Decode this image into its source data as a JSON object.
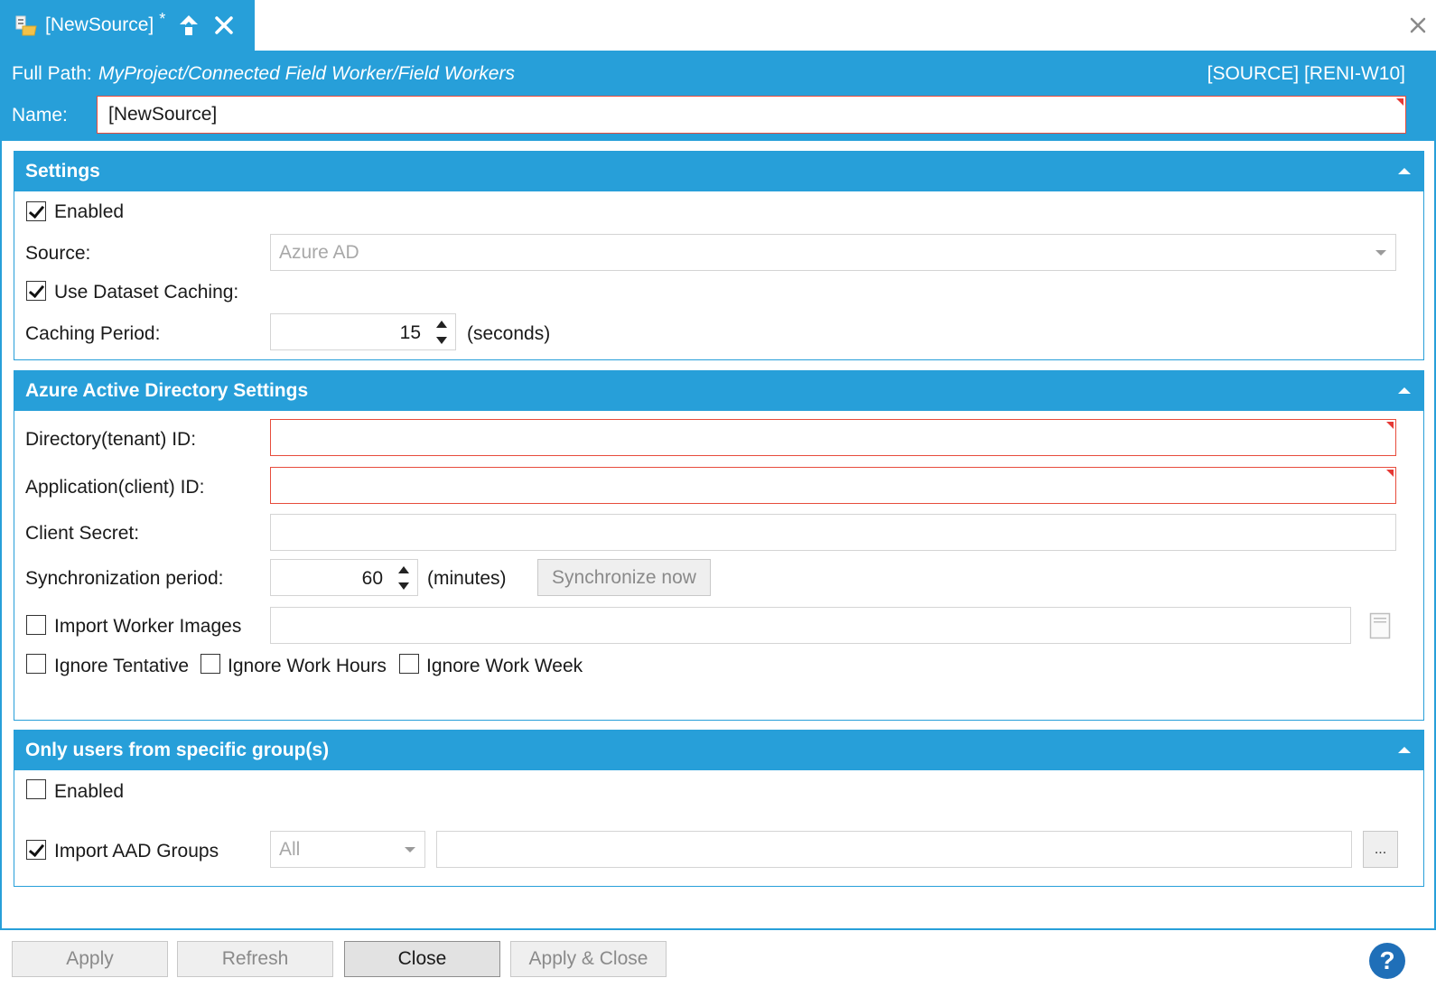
{
  "colors": {
    "accent": "#279fd9",
    "error": "#e74c3c",
    "help": "#1f6fb8"
  },
  "tab": {
    "title": "[NewSource]",
    "modified": "*",
    "icons": [
      "datasource-icon",
      "pin-up-icon",
      "close-icon"
    ]
  },
  "header": {
    "full_path_label": "Full Path:",
    "full_path_value": "MyProject/Connected Field Worker/Field Workers",
    "source_tag": "[SOURCE] [RENI-W10]",
    "name_label": "Name:",
    "name_value": "[NewSource]"
  },
  "settings": {
    "title": "Settings",
    "enabled_label": "Enabled",
    "enabled_checked": true,
    "source_label": "Source:",
    "source_value": "Azure AD",
    "caching_label": "Use Dataset Caching:",
    "caching_checked": true,
    "period_label": "Caching Period:",
    "period_value": "15",
    "period_unit": "(seconds)"
  },
  "aad": {
    "title": "Azure Active Directory Settings",
    "tenant_label": "Directory(tenant) ID:",
    "tenant_value": "",
    "client_label": "Application(client) ID:",
    "client_value": "",
    "secret_label": "Client Secret:",
    "secret_value": "",
    "sync_label": "Synchronization period:",
    "sync_value": "60",
    "sync_unit": "(minutes)",
    "sync_button": "Synchronize now",
    "import_images_label": "Import Worker Images",
    "import_images_checked": false,
    "ignore_tentative_label": "Ignore Tentative",
    "ignore_work_hours_label": "Ignore Work Hours",
    "ignore_work_week_label": "Ignore Work Week"
  },
  "groups": {
    "title": "Only users from specific group(s)",
    "enabled_label": "Enabled",
    "enabled_checked": false,
    "import_label": "Import AAD Groups",
    "import_checked": true,
    "filter_value": "All",
    "browse_label": "..."
  },
  "footer": {
    "apply": "Apply",
    "refresh": "Refresh",
    "close": "Close",
    "apply_close": "Apply & Close",
    "help": "?"
  }
}
